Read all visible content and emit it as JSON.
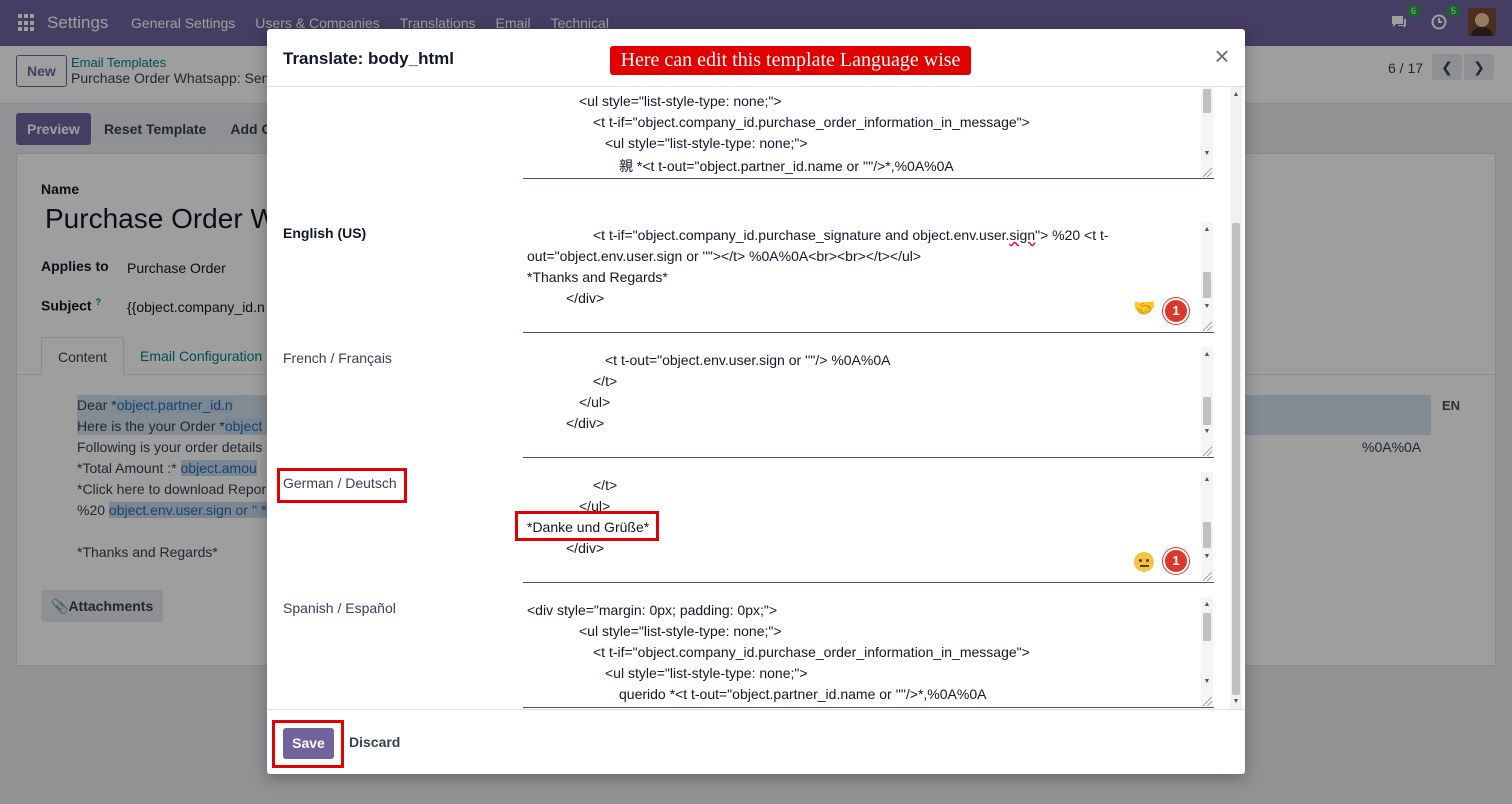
{
  "navbar": {
    "brand": "Settings",
    "menu": [
      "General Settings",
      "Users & Companies",
      "Translations",
      "Email",
      "Technical"
    ],
    "chat_count": "6",
    "activity_count": "5"
  },
  "control_panel": {
    "new_label": "New",
    "breadcrumb_parent": "Email Templates",
    "breadcrumb_current": "Purchase Order Whatsapp: Sen",
    "pager": "6 / 17"
  },
  "status_bar": {
    "preview": "Preview",
    "reset_template": "Reset Template",
    "add_partial": "Add C"
  },
  "form": {
    "name_label": "Name",
    "name_value": "Purchase Order W",
    "applies_to_label": "Applies to",
    "applies_to_value": "Purchase Order",
    "subject_label": "Subject",
    "subject_help": "?",
    "subject_value": "{{object.company_id.n",
    "tabs": [
      "Content",
      "Email Configuration"
    ],
    "body_lines": [
      {
        "plain": "       Dear *",
        "hl": "object.partner_id.n"
      },
      {
        "plain": "Here is the your Order *",
        "hl": "object"
      },
      {
        "plain": "Following is your order details",
        "hl": ""
      },
      {
        "plain": "*Total Amount :* ",
        "hl": "object.amou"
      },
      {
        "plain": "*Click here to download Repor",
        "hl": ""
      },
      {
        "plain": "%20 ",
        "hl": "object.env.user.sign or '' *"
      },
      {
        "plain": "",
        "hl": ""
      },
      {
        "plain": "*Thanks and Regards*",
        "hl": ""
      }
    ],
    "body_tail": "%0A%0A",
    "lang_badge": "EN",
    "attachments_label": "Attachments"
  },
  "modal": {
    "title": "Translate: body_html",
    "annotation": "Here can edit this template Language wise",
    "save_label": "Save",
    "discard_label": "Discard",
    "top_lines": [
      "<ul style=\"list-style-type: none;\">",
      "<t t-if=\"object.company_id.purchase_order_information_in_message\">",
      "<ul style=\"list-style-type: none;\">",
      "親 *<t t-out=\"object.partner_id.name or ''\"/>*,%0A%0A"
    ],
    "languages": [
      {
        "label": "English (US)",
        "lines": [
          "<t t-if=\"object.company_id.purchase_signature and object.env.user.",
          "sign",
          "\"> %20 <t t-",
          "out=\"object.env.user.sign or ''\"></t> %0A%0A<br><br></t></ul>",
          "*Thanks and Regards*",
          "</div>"
        ],
        "badge": "1"
      },
      {
        "label": "French / Français",
        "lines": [
          "<t t-out=\"object.env.user.sign or ''\"/> %0A%0A",
          "</t>",
          "</ul>",
          "</div>"
        ]
      },
      {
        "label": "German / Deutsch",
        "lines": [
          "</t>",
          "</ul>",
          "*Danke und Grüße*",
          "</div>"
        ],
        "badge": "1"
      },
      {
        "label": "Spanish / Español",
        "lines": [
          "<div style=\"margin: 0px; padding: 0px;\">",
          "<ul style=\"list-style-type: none;\">",
          "<t t-if=\"object.company_id.purchase_order_information_in_message\">",
          "<ul style=\"list-style-type: none;\">",
          "querido *<t t-out=\"object.partner_id.name or ''\"/>*,%0A%0A"
        ]
      }
    ]
  },
  "colors": {
    "brand": "#71639e",
    "annotation_red": "#e00000",
    "badge_red": "#d9382e"
  }
}
